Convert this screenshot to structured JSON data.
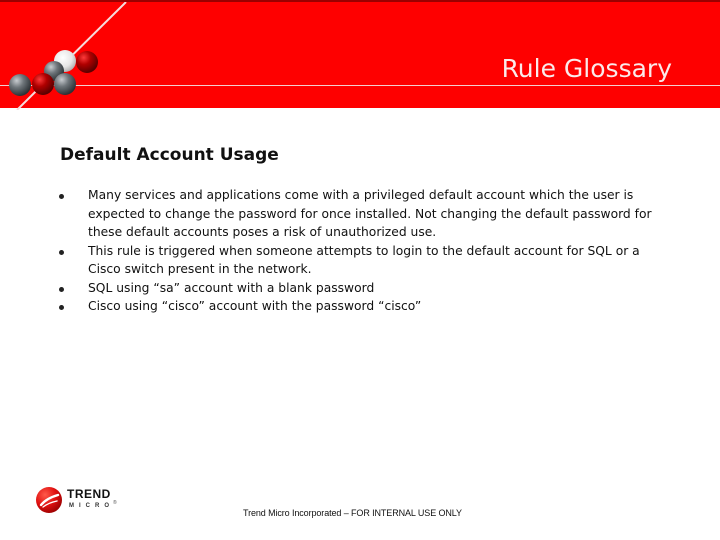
{
  "header": {
    "title": "Rule Glossary",
    "brand_color": "#fe0000",
    "decoration": "molecule-spheres-graphic"
  },
  "content": {
    "section_title": "Default Account Usage",
    "bullets": [
      {
        "text": "Many services and applications come with a privileged default account which the user is expected to change the password for once installed.  Not changing the default password for these default accounts poses a risk of unauthorized use."
      },
      {
        "text": "This rule is triggered when someone attempts to login to the default account for SQL or a Cisco switch present in the network."
      },
      {
        "text": "SQL using “sa” account with a blank password"
      },
      {
        "text": "Cisco using “cisco” account with the password “cisco”"
      }
    ]
  },
  "footer": {
    "logo": {
      "line1": "TREND",
      "line2": "MICRO",
      "registered": "®",
      "icon": "trend-micro-logo-icon"
    },
    "notice": "Trend Micro Incorporated – FOR INTERNAL USE ONLY"
  }
}
